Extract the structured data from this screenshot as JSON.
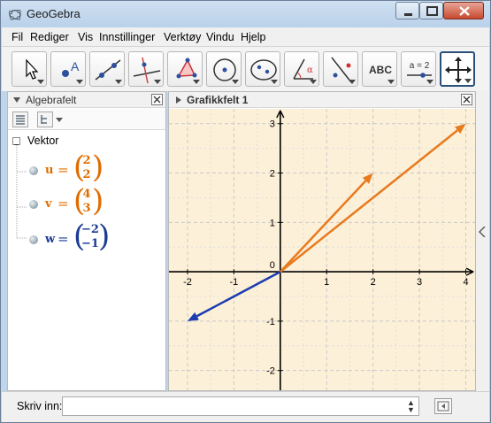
{
  "window": {
    "title": "GeoGebra"
  },
  "menu": [
    "Fil",
    "Rediger",
    "Vis",
    "Innstillinger",
    "Verktøy",
    "Vindu",
    "Hjelp"
  ],
  "toolbar": {
    "tools": [
      "move",
      "point",
      "line",
      "perpendicular",
      "polygon",
      "circle",
      "conic",
      "angle",
      "reflect",
      "text",
      "slider",
      "move-graphics"
    ],
    "text_tool_label": "ABC",
    "slider_tool_label": "a = 2",
    "selected": "move-graphics"
  },
  "algebra": {
    "title": "Algebrafelt",
    "group_label": "Vektor",
    "vectors": [
      {
        "name": "u",
        "eq": "=",
        "x": "2",
        "y": "2",
        "color": "#e06c00"
      },
      {
        "name": "v",
        "eq": "=",
        "x": "4",
        "y": "3",
        "color": "#e06c00"
      },
      {
        "name": "w",
        "eq": "=",
        "x": "−2",
        "y": "−1",
        "color": "#1c3c94"
      }
    ]
  },
  "graphics": {
    "title": "Grafikkfelt 1",
    "background": "#fdf0d8",
    "origin_label": "0",
    "x_ticks": [
      "-2",
      "-1",
      "1",
      "2",
      "3",
      "4"
    ],
    "y_ticks": [
      "3",
      "2",
      "1",
      "-1",
      "-2"
    ]
  },
  "chart_data": {
    "type": "scatter",
    "xlim": [
      -2.4,
      4.2
    ],
    "ylim": [
      -2.4,
      3.3
    ],
    "grid": true,
    "series": [
      {
        "name": "u",
        "color": "#e87a1e",
        "x": [
          0,
          2
        ],
        "y": [
          0,
          2
        ]
      },
      {
        "name": "v",
        "color": "#e87a1e",
        "x": [
          0,
          4
        ],
        "y": [
          0,
          3
        ]
      },
      {
        "name": "w",
        "color": "#1c3cb0",
        "x": [
          0,
          -2
        ],
        "y": [
          0,
          -1
        ]
      }
    ]
  },
  "input": {
    "label": "Skriv inn:",
    "value": ""
  }
}
